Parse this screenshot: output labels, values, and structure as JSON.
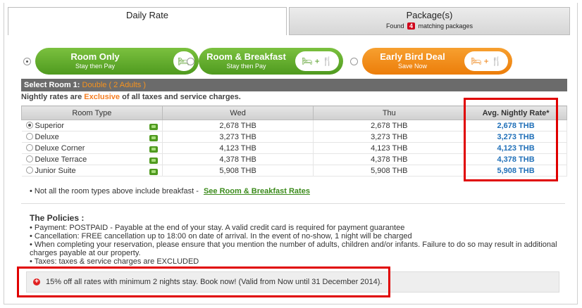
{
  "tabs": {
    "daily": {
      "label": "Daily Rate"
    },
    "package": {
      "label": "Package(s)",
      "found_prefix": "Found",
      "count": "4",
      "found_suffix": "matching packages"
    }
  },
  "options": [
    {
      "title": "Room Only",
      "sub": "Stay then Pay",
      "selected": true,
      "color": "#5fa82b",
      "icons": [
        "bed-icon"
      ]
    },
    {
      "title": "Room & Breakfast",
      "sub": "Stay then Pay",
      "selected": false,
      "color": "#5fa82b",
      "icons": [
        "bed-icon",
        "plus-icon",
        "cutlery-icon"
      ]
    },
    {
      "title": "Early Bird Deal",
      "sub": "Save Now",
      "selected": false,
      "color": "#ef8a14",
      "icons": [
        "bed-icon",
        "plus-icon",
        "cutlery-icon"
      ]
    }
  ],
  "room_bar": {
    "label": "Select Room 1:",
    "room_type": "Double ( 2 Adults )"
  },
  "note": {
    "prefix": "Nightly rates are",
    "highlight": "Exclusive",
    "suffix": "of all taxes and service charges."
  },
  "table": {
    "headers": [
      "Room Type",
      "Wed",
      "Thu",
      "Avg. Nightly Rate*"
    ],
    "rows": [
      {
        "name": "Superior",
        "selected": true,
        "wed": "2,678 THB",
        "thu": "2,678 THB",
        "avg": "2,678 THB"
      },
      {
        "name": "Deluxe",
        "selected": false,
        "wed": "3,273 THB",
        "thu": "3,273 THB",
        "avg": "3,273 THB"
      },
      {
        "name": "Deluxe Corner",
        "selected": false,
        "wed": "4,123 THB",
        "thu": "4,123 THB",
        "avg": "4,123 THB"
      },
      {
        "name": "Deluxe Terrace",
        "selected": false,
        "wed": "4,378 THB",
        "thu": "4,378 THB",
        "avg": "4,378 THB"
      },
      {
        "name": "Junior Suite",
        "selected": false,
        "wed": "5,908 THB",
        "thu": "5,908 THB",
        "avg": "5,908 THB"
      }
    ]
  },
  "breakfast_note": {
    "text": "• Not all the room types above include breakfast -",
    "link": "See Room & Breakfast Rates"
  },
  "policies": {
    "title": "The Policies :",
    "items": [
      "• Payment: POSTPAID - Payable at the end of your stay. A valid credit card is required for payment guarantee",
      "• Cancellation: FREE cancellation up to 18:00 on date of arrival. In the event of no-show, 1 night will be charged",
      "• When completing your reservation, please ensure that you mention the number of adults, children and/or infants. Failure to do so may result in additional charges payable at our property.",
      "• Taxes: taxes & service charges are EXCLUDED"
    ]
  },
  "promo": {
    "icon": "plus-circle-icon",
    "text": "15% off all rates with minimum 2 nights stay. Book now! (Valid from Now until 31 December 2014)."
  },
  "colors": {
    "accent_green": "#5fa82b",
    "accent_orange": "#ef8a14",
    "link_blue": "#1f6fb8",
    "highlight_red": "#e00000"
  }
}
